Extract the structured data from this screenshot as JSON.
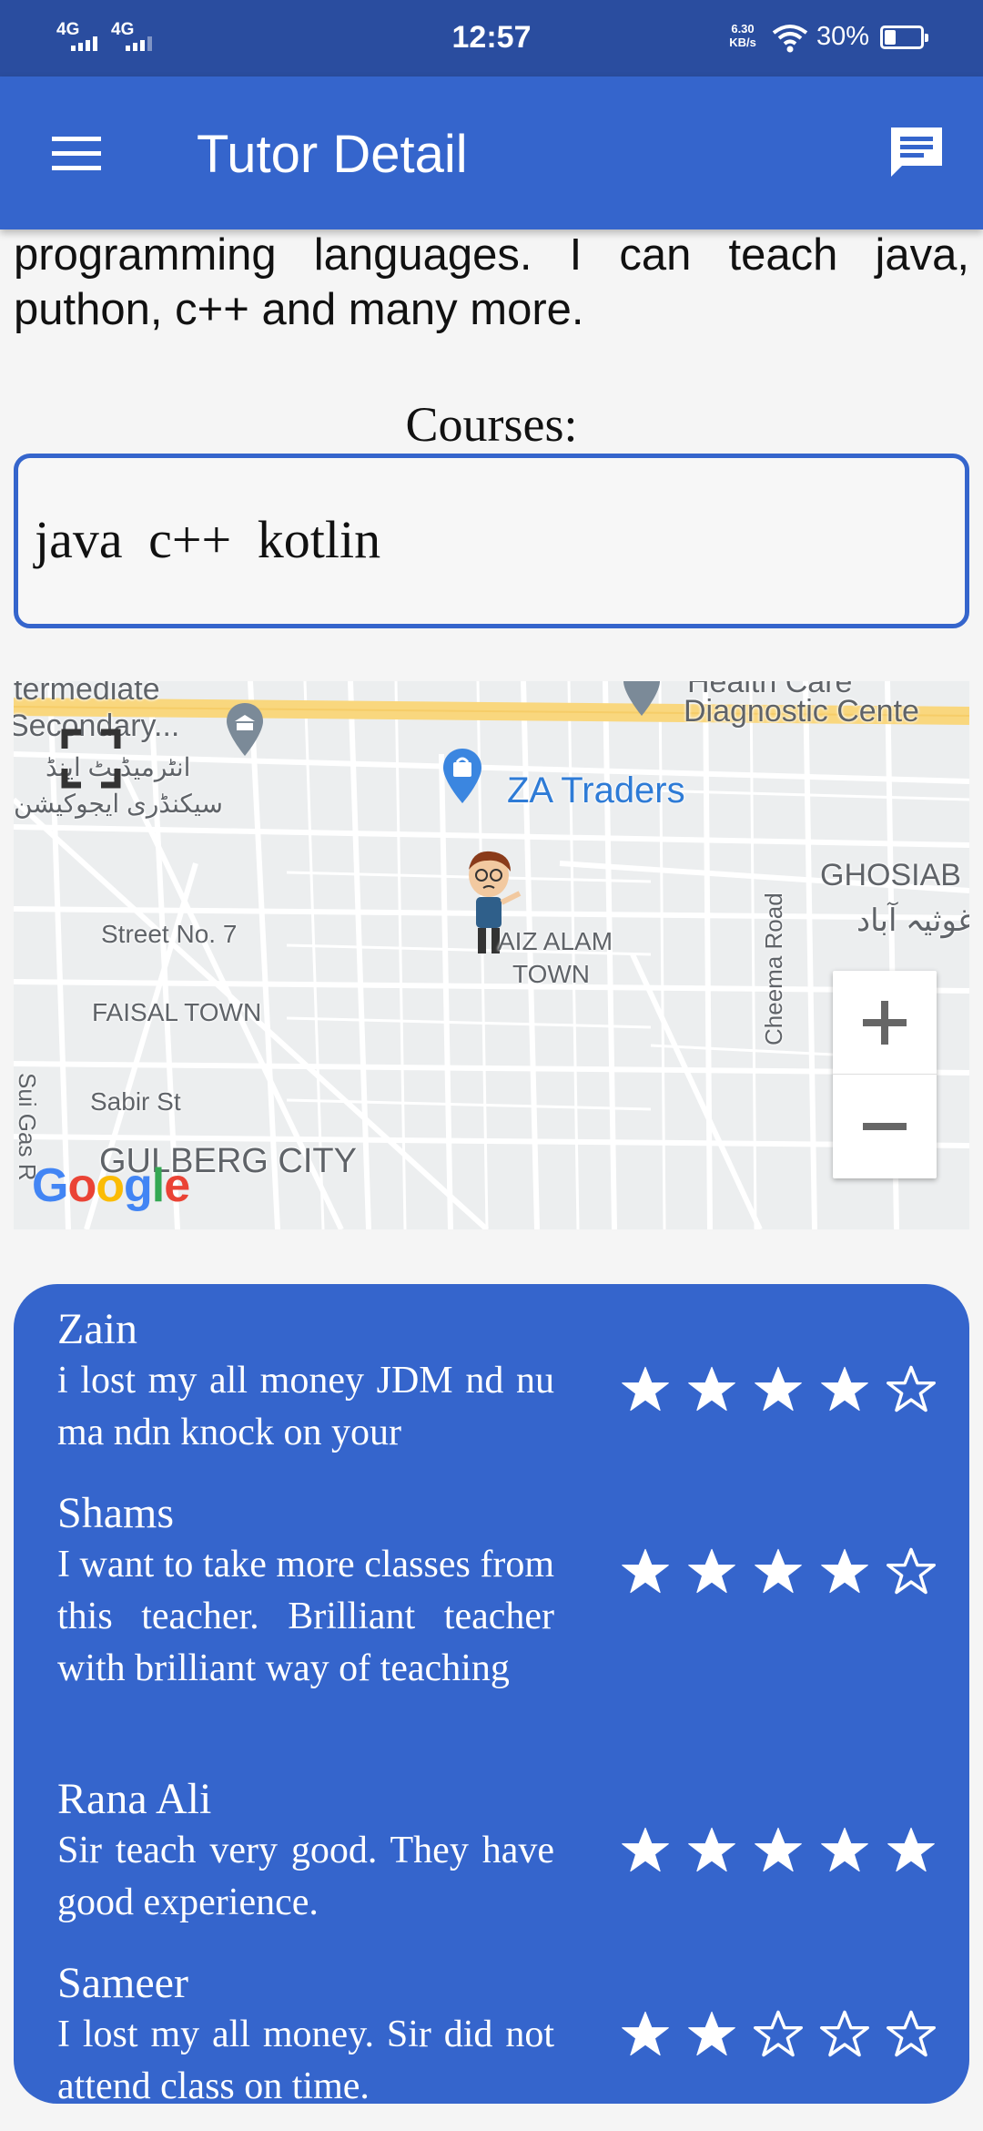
{
  "status_bar": {
    "signal_1": "4G",
    "signal_2": "4G",
    "time": "12:57",
    "net_speed_value": "6.30",
    "net_speed_unit": "KB/s",
    "battery": "30%",
    "battery_level": 0.3
  },
  "app_bar": {
    "title": "Tutor Detail",
    "menu_icon": "menu-icon",
    "chat_icon": "chat-icon"
  },
  "description": "programming languages. I can teach java, puthon, c++ and many more.",
  "courses": {
    "label": "Courses:",
    "value": "java  c++  kotlin"
  },
  "map": {
    "labels": {
      "intermediate": "termediate",
      "secondary": "Secondary...",
      "urdu_intermediate": "انٹرمیڈیٹ اینڈ",
      "urdu_secondary": "سیکنڈری ایجوکیشن",
      "health_care": "Health Care",
      "diagnostic": "Diagnostic Cente",
      "za_traders": "ZA Traders",
      "ghosia": "GHOSIAB",
      "ghosia_urdu": "غوثیہ آباد",
      "street7": "Street No. 7",
      "faiz_alam": "AIZ ALAM",
      "town": "TOWN",
      "faisal_town": "FAISAL TOWN",
      "cheema_road": "Cheema Road",
      "sui_gas": "Sui Gas R",
      "sabir_st": "Sabir St",
      "gulberg": "GULBERG CITY",
      "google": "Google"
    },
    "zoom_in_icon": "plus-icon",
    "zoom_out_icon": "minus-icon"
  },
  "reviews": [
    {
      "name": "Zain",
      "text": "i lost my all money JDM nd nu ma ndn knock on your",
      "rating": 4
    },
    {
      "name": "Shams",
      "text": "I want to take more classes from this teacher. Brilliant teacher with brilliant way of teaching",
      "rating": 4
    },
    {
      "name": "Rana Ali",
      "text": "Sir teach very good. They have good experience.",
      "rating": 5
    },
    {
      "name": "Sameer",
      "text": "I lost my all money. Sir did not attend class on time.",
      "rating": 2
    }
  ],
  "colors": {
    "status_bar": "#2a4d9f",
    "app_bar": "#3565cc",
    "accent": "#3565cc"
  }
}
